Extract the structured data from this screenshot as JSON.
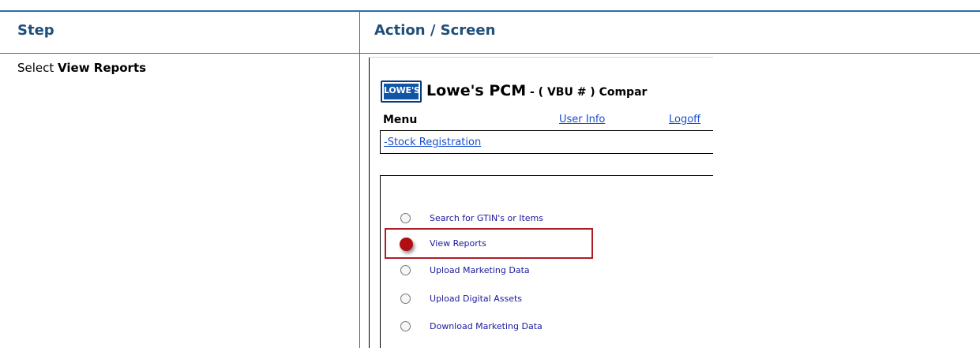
{
  "table": {
    "header_step": "Step",
    "header_action": "Action / Screen",
    "step_prefix": "Select ",
    "step_bold": "View Reports"
  },
  "screenshot": {
    "logo_text": "LOWE'S",
    "app_title": "Lowe's PCM",
    "app_subtitle": " - ( VBU # ) Compar",
    "menu_label": "Menu",
    "user_info_link": "User Info",
    "logoff_link": "Logoff",
    "stock_registration_link": "-Stock Registration",
    "options": [
      {
        "label": "Search for GTIN's or Items",
        "selected": false
      },
      {
        "label": "View Reports",
        "selected": true
      },
      {
        "label": "Upload Marketing Data",
        "selected": false
      },
      {
        "label": "Upload Digital Assets",
        "selected": false
      },
      {
        "label": "Download Marketing Data",
        "selected": false
      }
    ],
    "highlight_color": "#b01c25",
    "accent_color": "#1f4e79"
  }
}
